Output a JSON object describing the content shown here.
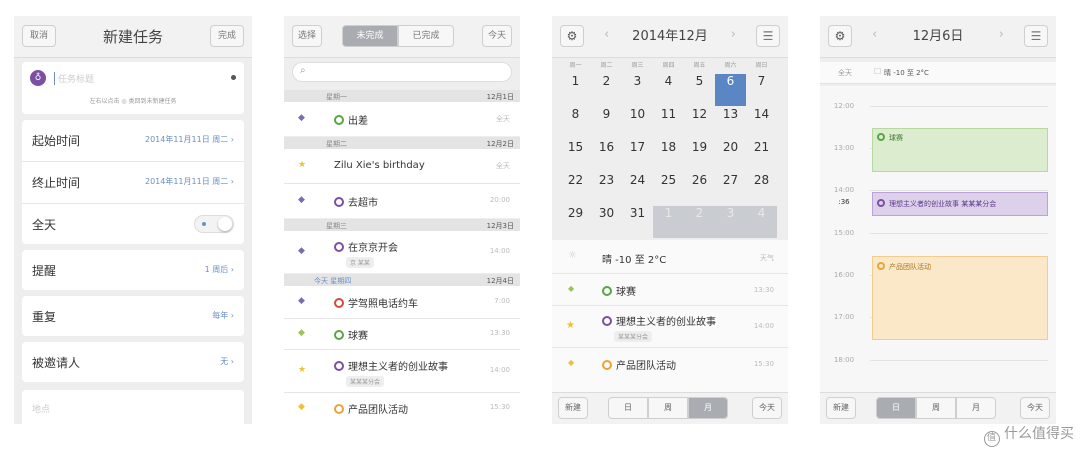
{
  "colors": {
    "accent_blue": "#5b86c4",
    "event_green": "#57a645",
    "event_purple": "#7b4fa3",
    "event_orange": "#e9a53a",
    "event_red": "#d64a3a",
    "bg": "#eeeeee"
  },
  "screen1": {
    "cancel": "取消",
    "title": "新建任务",
    "done": "完成",
    "title_placeholder": "任务标题",
    "hint": "左右以点击 ◎ 类回到未新建任务",
    "start_label": "起始时间",
    "start_value": "2014年11月11日 周二 ›",
    "end_label": "终止时间",
    "end_value": "2014年11月11日 周二 ›",
    "allday_label": "全天",
    "remind_label": "提醒",
    "remind_value": "1 周后 ›",
    "repeat_label": "重复",
    "repeat_value": "每年 ›",
    "invite_label": "被邀请人",
    "invite_value": "无 ›",
    "location_placeholder": "地点"
  },
  "screen2": {
    "select": "选择",
    "tab_todo": "未完成",
    "tab_done": "已完成",
    "today": "今天",
    "search_icon": "search-icon",
    "groups": [
      {
        "label": "星期一",
        "date": "12月1日"
      },
      {
        "label": "星期二",
        "date": "12月2日"
      },
      {
        "label": "星期三",
        "date": "12月3日"
      },
      {
        "label": "今天 星期四",
        "date": "12月4日"
      }
    ],
    "items": [
      {
        "mark": "◆",
        "title": "出差",
        "time": "全天"
      },
      {
        "mark": "★",
        "title": "Zilu Xie's birthday",
        "time": "全天"
      },
      {
        "mark": "◆",
        "title": "去超市",
        "time": "20:00"
      },
      {
        "mark": "◆",
        "title": "在京京开会",
        "time": "14:00",
        "tag": "京 某某"
      },
      {
        "mark": "◆",
        "title": "学驾照电话约车",
        "time": "7:00"
      },
      {
        "mark": "◆",
        "title": "球赛",
        "time": "13:30"
      },
      {
        "mark": "★",
        "title": "理想主义者的创业故事",
        "time": "14:00",
        "tag": "某某某分会"
      },
      {
        "mark": "◆",
        "title": "产品团队活动",
        "time": "15:30"
      }
    ]
  },
  "screen3": {
    "title": "2014年12月",
    "weekdays": [
      "周一",
      "周二",
      "周三",
      "周四",
      "周五",
      "周六",
      "周日"
    ],
    "weeks": [
      [
        "1",
        "2",
        "3",
        "4",
        "5",
        "6",
        "7"
      ],
      [
        "8",
        "9",
        "10",
        "11",
        "12",
        "13",
        "14"
      ],
      [
        "15",
        "16",
        "17",
        "18",
        "19",
        "20",
        "21"
      ],
      [
        "22",
        "23",
        "24",
        "25",
        "26",
        "27",
        "28"
      ],
      [
        "29",
        "30",
        "31",
        "1",
        "2",
        "3",
        "4"
      ]
    ],
    "selected_day": "6",
    "weather": "晴 -10 至 2°C",
    "weather_right": "天气",
    "events": [
      {
        "title": "球赛",
        "time": "13:30"
      },
      {
        "title": "理想主义者的创业故事",
        "time": "14:00",
        "tag": "某某某分会"
      },
      {
        "title": "产品团队活动",
        "time": "15:30"
      }
    ],
    "new": "新建",
    "seg_day": "日",
    "seg_week": "周",
    "seg_month": "月",
    "today": "今天"
  },
  "screen4": {
    "title": "12月6日",
    "allday": "全天",
    "weather": "晴 -10 至 2°C",
    "hours": [
      "12:00",
      "13:00",
      "14:00",
      "15:00",
      "16:00",
      "17:00",
      "18:00"
    ],
    "now": ":36",
    "ev1": "球赛",
    "ev2": "理想主义者的创业故事 某某某分会",
    "ev3": "产品团队活动",
    "new": "新建",
    "seg_day": "日",
    "seg_week": "周",
    "seg_month": "月",
    "today": "今天"
  },
  "watermark": "什么值得买"
}
